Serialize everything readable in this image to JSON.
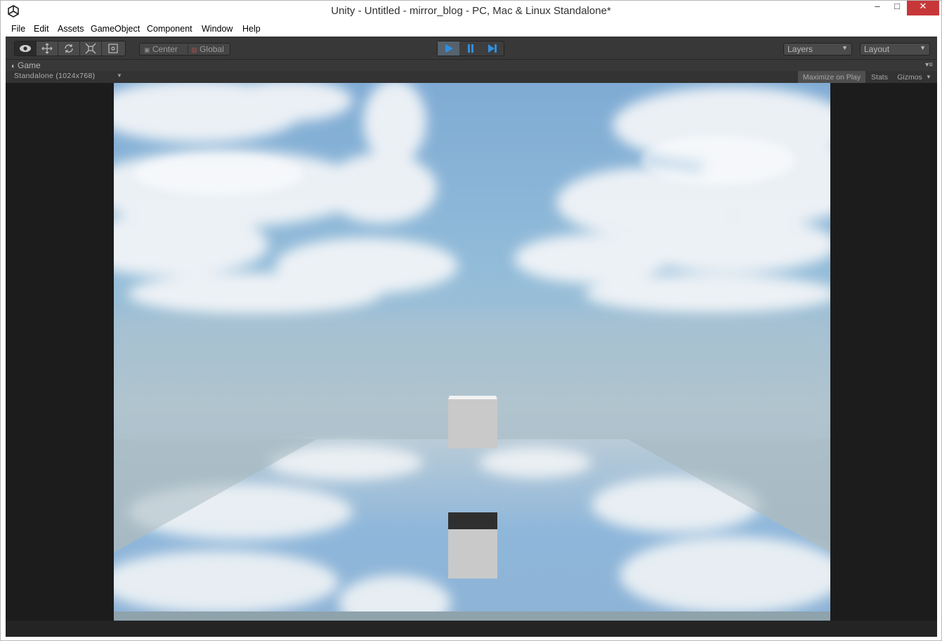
{
  "window": {
    "title": "Unity - Untitled - mirror_blog - PC, Mac & Linux Standalone*",
    "controls": {
      "minimize": "–",
      "maximize": "□",
      "close": "✕"
    }
  },
  "menu": [
    "File",
    "Edit",
    "Assets",
    "GameObject",
    "Component",
    "Window",
    "Help"
  ],
  "toolbar": {
    "transform_tools": [
      "eye-icon",
      "move-icon",
      "rotate-icon",
      "scale-icon",
      "rect-icon"
    ],
    "pivot": {
      "center_label": "Center",
      "global_label": "Global"
    },
    "playback": [
      "play-icon",
      "pause-icon",
      "step-icon"
    ],
    "layers_label": "Layers",
    "layout_label": "Layout"
  },
  "game_view": {
    "tab_label": "Game",
    "aspect_label": "Standalone (1024x768)",
    "maximize_label": "Maximize on Play",
    "stats_label": "Stats",
    "gizmos_label": "Gizmos"
  },
  "colors": {
    "editor_dark": "#383838",
    "play_active": "#56636f",
    "play_icon": "#2f8fe0",
    "close_button": "#c7373a",
    "sky_top": "#8db5d8",
    "horizon": "#a9bac5"
  }
}
